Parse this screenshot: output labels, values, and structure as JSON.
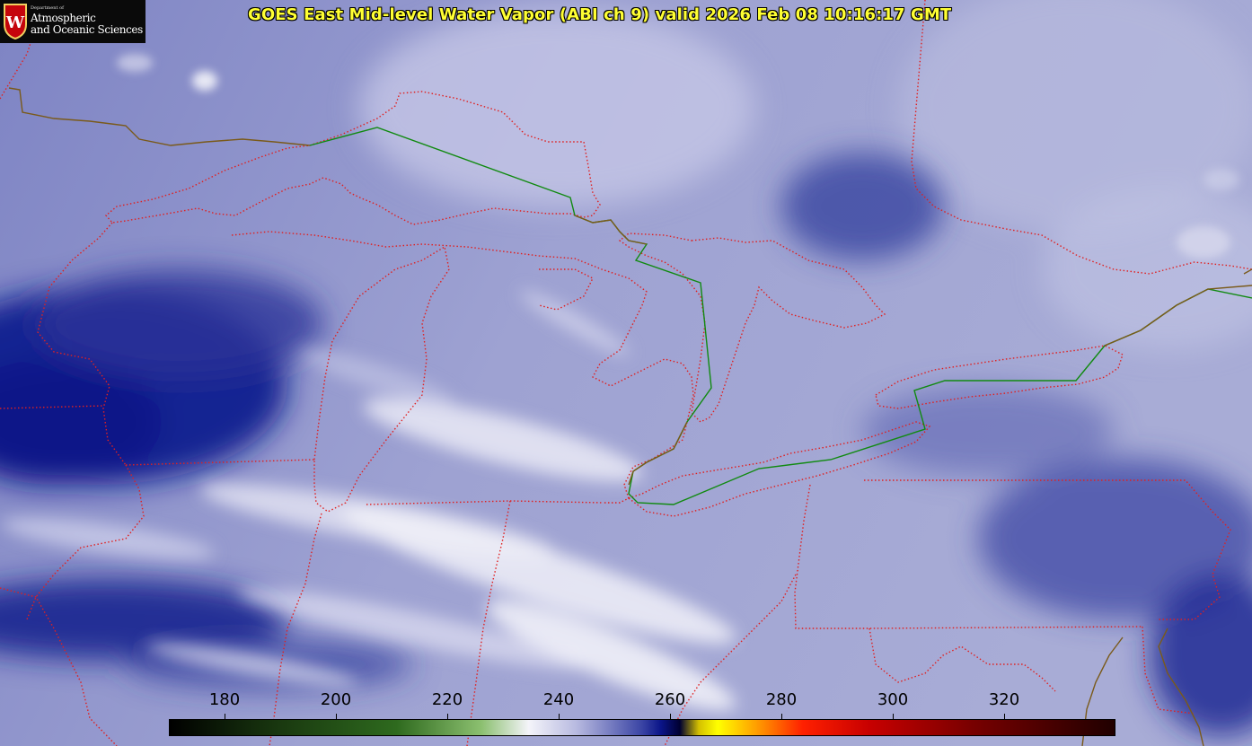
{
  "logo": {
    "department": "Department of",
    "line1": "Atmospheric",
    "line2": "and Oceanic Sciences",
    "crest_letter": "W"
  },
  "title": "GOES East Mid-level Water Vapor (ABI ch 9)  valid 2026 Feb 08 10:16:17 GMT",
  "colorbar": {
    "min": 170,
    "max": 340,
    "ticks": [
      {
        "value": 180,
        "label": "180"
      },
      {
        "value": 200,
        "label": "200"
      },
      {
        "value": 220,
        "label": "220"
      },
      {
        "value": 240,
        "label": "240"
      },
      {
        "value": 260,
        "label": "260"
      },
      {
        "value": 280,
        "label": "280"
      },
      {
        "value": 300,
        "label": "300"
      },
      {
        "value": 320,
        "label": "320"
      }
    ]
  },
  "colors": {
    "state_borders": "#e02020",
    "international_border": "#118a11",
    "coastline": "#7a5a1a",
    "title_text": "#ffff33",
    "moist_white": "#f2f2fa",
    "mid_lavender": "#8c90c8",
    "dry_navy": "#0a1488"
  }
}
